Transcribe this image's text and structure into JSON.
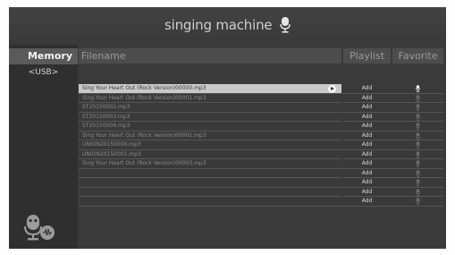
{
  "header": {
    "brand": "singing machine"
  },
  "sidebar": {
    "title": "Memory",
    "subtitle": "<USB>"
  },
  "columns": {
    "filename": "Filename",
    "playlist": "Playlist",
    "favorite": "Favorite"
  },
  "rows": [
    {
      "filename": "Sing Your Heart Out (Rock Version)00000.mp3",
      "playlist": "Add",
      "selected": true
    },
    {
      "filename": "Sing Your Heart Out (Rock Version)00001.mp3",
      "playlist": "Add"
    },
    {
      "filename": "ST20150002.mp3",
      "playlist": "Add"
    },
    {
      "filename": "ST20150003.mp3",
      "playlist": "Add"
    },
    {
      "filename": "ST20150004.mp3",
      "playlist": "Add"
    },
    {
      "filename": "Sing Your Heart Out (Rock Version)00002.mp3",
      "playlist": "Add"
    },
    {
      "filename": "UNION20150000.mp3",
      "playlist": "Add"
    },
    {
      "filename": "UNION20150001.mp3",
      "playlist": "Add"
    },
    {
      "filename": "Sing Your Heart Out (Rock Version)00003.mp3",
      "playlist": "Add"
    },
    {
      "filename": "",
      "playlist": "Add"
    },
    {
      "filename": "",
      "playlist": "Add"
    },
    {
      "filename": "",
      "playlist": "Add"
    },
    {
      "filename": "",
      "playlist": "Add"
    }
  ],
  "icons": {
    "brand": "microphone-icon",
    "play": "play-icon",
    "favorite": "microphone-icon",
    "sidebar": "microphone-soundwave-icon"
  },
  "colors": {
    "background": "#3a3a3a",
    "header": "#4d4d4d",
    "selected_row": "#c9c9c9",
    "favorite_active": "#f4f4f4",
    "favorite_inactive": "#6e6e6e"
  }
}
